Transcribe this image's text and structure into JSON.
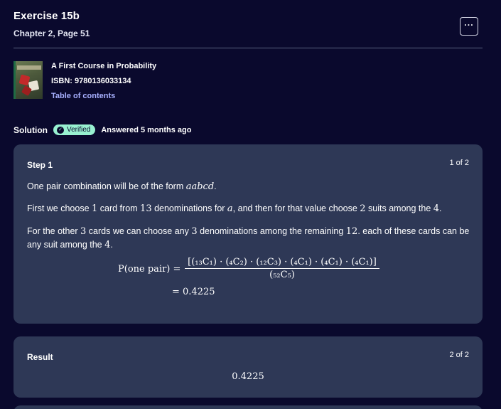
{
  "header": {
    "title": "Exercise 15b",
    "subtitle": "Chapter 2, Page 51",
    "more_label": "···"
  },
  "book": {
    "cover_icon": "book-cover-image",
    "title": "A First Course in Probability",
    "isbn": "ISBN: 9780136033134",
    "toc_link": "Table of contents"
  },
  "solution": {
    "label": "Solution",
    "badge": "Verified",
    "badge_icon": "check-circle-icon",
    "answered": "Answered 5 months ago"
  },
  "step": {
    "heading": "Step 1",
    "counter": "1 of 2",
    "p1_a": "One pair combination will be of the form ",
    "p1_math": "aabcd",
    "p1_b": ".",
    "p2_a": "First we choose ",
    "p2_m1": "1",
    "p2_b": " card from ",
    "p2_m2": "13",
    "p2_c": " denominations for ",
    "p2_m3": "a",
    "p2_d": ", and then for that value choose ",
    "p2_m4": "2",
    "p2_e": " suits among the ",
    "p2_m5": "4",
    "p2_f": ".",
    "p3_a": "For the other ",
    "p3_m1": "3",
    "p3_b": " cards we can choose any ",
    "p3_m2": "3",
    "p3_c": " denominations among the remaining ",
    "p3_m3": "12",
    "p3_d": ". each of these cards can be any suit among the ",
    "p3_m4": "4",
    "p3_e": ".",
    "eq_lhs": "P(one pair) =",
    "eq_numerator": "[(₁₃C₁) · (₄C₂) · (₁₂C₃) · (₄C₁) · (₄C₁) · (₄C₁)]",
    "eq_denominator": "(₅₂C₅)",
    "eq_result": "= 0.4225"
  },
  "result": {
    "heading": "Result",
    "counter": "2 of 2",
    "value": "0.4225"
  },
  "colors": {
    "background": "#0a092d",
    "card": "#2e3856",
    "badge": "#98f1d1",
    "link": "#a8b1ff"
  }
}
